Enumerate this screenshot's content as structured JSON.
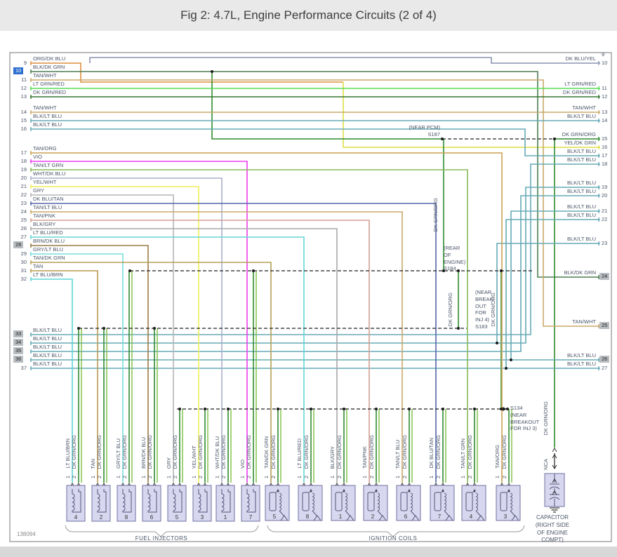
{
  "title": "Fig 2: 4.7L, Engine Performance Circuits (2 of 4)",
  "watermark": "138094",
  "colors": {
    "ORG/DK BLU": "#dd8f3c",
    "BLK/DK GRN": "#4d7d52",
    "TAN/WHT": "#c9a96a",
    "LT GRN/RED": "#55dd55",
    "DK GRN/RED": "#35752f",
    "BLK/LT BLU": "#66aab5",
    "TAN/ORG": "#c9a250",
    "VIO": "#ee3cee",
    "TAN/LT GRN": "#86b95a",
    "WHT/DK BLU": "#a8b0cc",
    "YEL/WHT": "#eeee55",
    "GRY": "#b5b5b5",
    "DK BLU/TAN": "#5566aa",
    "TAN/LT BLU": "#c9a96a",
    "TAN/PNK": "#d4a090",
    "BLK/GRY": "#a8a8a8",
    "LT BLU/RED": "#66d5d5",
    "BRN/DK BLU": "#9a7a45",
    "GRY/LT BLU": "#77dddd",
    "TAN/DK GRN": "#b5a055",
    "TAN": "#bb9a50",
    "LT BLU/BRN": "#5cd5d5",
    "DK GRN/ORG": "#2e8b2e",
    "DK GRN/ORG_2": "#7cbf3f",
    "DK BLU/YEL": "#8a93b0",
    "YEL/DK GRN": "#dede45"
  },
  "left_pins": [
    {
      "pin": "9",
      "label": "ORG/DK BLU",
      "hl": ""
    },
    {
      "pin": "10",
      "label": "BLK/DK GRN",
      "hl": "blue"
    },
    {
      "pin": "11",
      "label": "TAN/WHT",
      "hl": ""
    },
    {
      "pin": "12",
      "label": "LT GRN/RED",
      "hl": ""
    },
    {
      "pin": "13",
      "label": "DK GRN/RED",
      "hl": ""
    },
    {
      "pin": "14",
      "label": "TAN/WHT",
      "hl": ""
    },
    {
      "pin": "15",
      "label": "BLK/LT BLU",
      "hl": ""
    },
    {
      "pin": "16",
      "label": "BLK/LT BLU",
      "hl": ""
    },
    {
      "pin": "17",
      "label": "TAN/ORG",
      "hl": ""
    },
    {
      "pin": "18",
      "label": "VIO",
      "hl": ""
    },
    {
      "pin": "19",
      "label": "TAN/LT GRN",
      "hl": ""
    },
    {
      "pin": "20",
      "label": "WHT/DK BLU",
      "hl": ""
    },
    {
      "pin": "21",
      "label": "YEL/WHT",
      "hl": ""
    },
    {
      "pin": "22",
      "label": "GRY",
      "hl": ""
    },
    {
      "pin": "23",
      "label": "DK BLU/TAN",
      "hl": ""
    },
    {
      "pin": "24",
      "label": "TAN/LT BLU",
      "hl": ""
    },
    {
      "pin": "25",
      "label": "TAN/PNK",
      "hl": ""
    },
    {
      "pin": "26",
      "label": "BLK/GRY",
      "hl": ""
    },
    {
      "pin": "27",
      "label": "LT BLU/RED",
      "hl": ""
    },
    {
      "pin": "28",
      "label": "BRN/DK BLU",
      "hl": "gray"
    },
    {
      "pin": "29",
      "label": "GRY/LT BLU",
      "hl": ""
    },
    {
      "pin": "30",
      "label": "TAN/DK GRN",
      "hl": ""
    },
    {
      "pin": "31",
      "label": "TAN",
      "hl": ""
    },
    {
      "pin": "32",
      "label": "LT BLU/BRN",
      "hl": ""
    },
    {
      "pin": "33",
      "label": "BLK/LT BLU",
      "hl": "gray"
    },
    {
      "pin": "34",
      "label": "BLK/LT BLU",
      "hl": "gray"
    },
    {
      "pin": "35",
      "label": "BLK/LT BLU",
      "hl": "gray"
    },
    {
      "pin": "36",
      "label": "BLK/LT BLU",
      "hl": "gray"
    },
    {
      "pin": "37",
      "label": "BLK/LT BLU",
      "hl": ""
    }
  ],
  "right_pins": [
    {
      "pin": "9",
      "label": "",
      "hl": ""
    },
    {
      "pin": "10",
      "label": "DK BLU/YEL",
      "hl": ""
    },
    {
      "pin": "11",
      "label": "LT GRN/RED",
      "hl": ""
    },
    {
      "pin": "12",
      "label": "DK GRN/RED",
      "hl": ""
    },
    {
      "pin": "13",
      "label": "TAN/WHT",
      "hl": ""
    },
    {
      "pin": "14",
      "label": "BLK/LT BLU",
      "hl": ""
    },
    {
      "pin": "15",
      "label": "DK GRN/ORG",
      "hl": ""
    },
    {
      "pin": "16",
      "label": "YEL/DK GRN",
      "hl": ""
    },
    {
      "pin": "17",
      "label": "BLK/LT BLU",
      "hl": ""
    },
    {
      "pin": "18",
      "label": "BLK/LT BLU",
      "hl": ""
    },
    {
      "pin": "19",
      "label": "BLK/LT BLU",
      "hl": ""
    },
    {
      "pin": "20",
      "label": "BLK/LT BLU",
      "hl": ""
    },
    {
      "pin": "21",
      "label": "BLK/LT BLU",
      "hl": ""
    },
    {
      "pin": "22",
      "label": "BLK/LT BLU",
      "hl": ""
    },
    {
      "pin": "23",
      "label": "BLK/LT BLU",
      "hl": ""
    },
    {
      "pin": "24",
      "label": "BLK/DK GRN",
      "hl": "gray"
    },
    {
      "pin": "25",
      "label": "TAN/WHT",
      "hl": "gray"
    },
    {
      "pin": "26",
      "label": "BLK/LT BLU",
      "hl": "gray"
    },
    {
      "pin": "27",
      "label": "BLK/LT BLU",
      "hl": ""
    }
  ],
  "injectors": [
    {
      "num": "4",
      "color": "LT BLU/BRN"
    },
    {
      "num": "2",
      "color": "TAN"
    },
    {
      "num": "8",
      "color": "GRY/LT BLU"
    },
    {
      "num": "6",
      "color": "BRN/DK BLU"
    },
    {
      "num": "5",
      "color": "GRY"
    },
    {
      "num": "3",
      "color": "YEL/WHT"
    },
    {
      "num": "1",
      "color": "WHT/DK BLU"
    },
    {
      "num": "7",
      "color": "VIO"
    }
  ],
  "coils": [
    {
      "num": "5",
      "color": "TAN/DK GRN"
    },
    {
      "num": "8",
      "color": "LT BLU/RED"
    },
    {
      "num": "1",
      "color": "BLK/GRY"
    },
    {
      "num": "2",
      "color": "TAN/PNK"
    },
    {
      "num": "6",
      "color": "TAN/LT BLU"
    },
    {
      "num": "7",
      "color": "DK BLU/TAN"
    },
    {
      "num": "4",
      "color": "TAN/LT GRN"
    },
    {
      "num": "3",
      "color": "TAN/ORG"
    }
  ],
  "pin2_color": "DK GRN/ORG",
  "pin_numbers": [
    "1",
    "2"
  ],
  "splices": {
    "s187": "(NEAR PCM)\nS187",
    "s184": "(REAR\nOF\nENGINE)\nS184",
    "s183": "(NEAR\nBREAK-\nOUT\nFOR\nINJ 4)\nS183",
    "s134": "S134\n(NEAR\nBREAKOUT\nFOR INJ 3)"
  },
  "bus_labels": [
    "DK GRN/ORG",
    "DK GRN/ORG",
    "DK GRN/ORG",
    "DK GRN/ORG",
    "NCA"
  ],
  "groups": {
    "injectors": "FUEL INJECTORS",
    "coils": "IGNITION COILS"
  },
  "capacitor_label": "CAPACITOR\n(RIGHT SIDE\nOF ENGINE\nCOMPT)"
}
